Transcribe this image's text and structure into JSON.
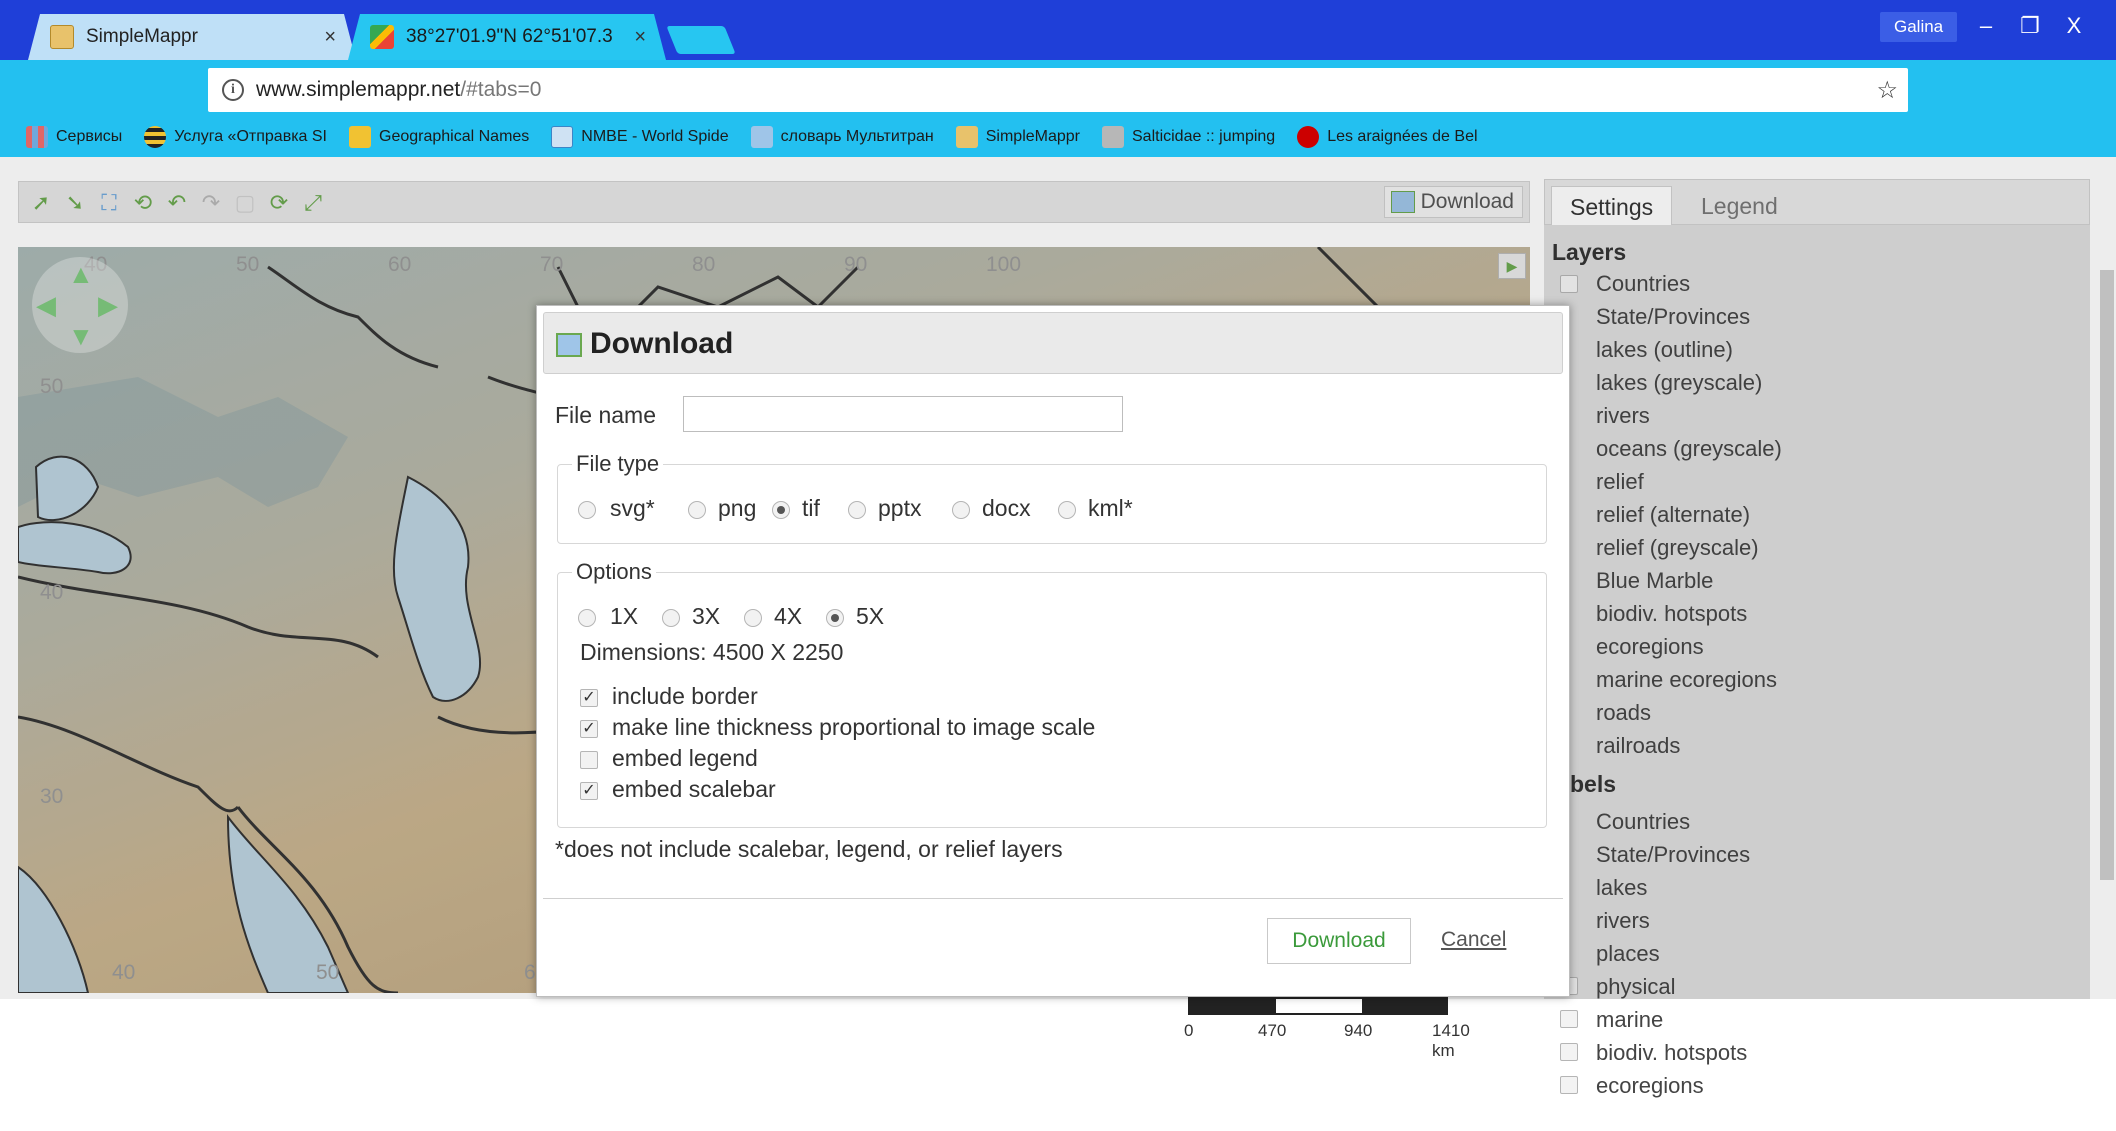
{
  "browser": {
    "tabs": [
      {
        "title": "SimpleMappr",
        "close": "×"
      },
      {
        "title": "38°27'01.9\"N 62°51'07.3",
        "close": "×"
      }
    ],
    "user": "Galina",
    "window_controls": {
      "minimize": "–",
      "restore": "❐",
      "close": "X"
    },
    "url": {
      "host": "www.simplemappr.net",
      "path": "/#tabs=0"
    },
    "bookmarks": [
      "Сервисы",
      "Услуга «Отправка SI",
      "Geographical Names",
      "NMBE - World Spide",
      "словарь Мультитран",
      "SimpleMappr",
      "Salticidae :: jumping",
      "Les araignées de Bel"
    ]
  },
  "toolbar": {
    "download_label": "Download",
    "tools": [
      "zoom-in",
      "zoom-out",
      "crop",
      "rotate",
      "undo",
      "redo",
      "blank",
      "refresh",
      "fullscreen"
    ]
  },
  "map": {
    "top_ticks": [
      "40",
      "50",
      "60",
      "70",
      "80",
      "90",
      "100"
    ],
    "left_ticks": [
      "50",
      "40",
      "30"
    ],
    "bottom_ticks": [
      "40",
      "50",
      "6"
    ],
    "scalebar": [
      "0",
      "470",
      "940",
      "1410 km"
    ]
  },
  "panel": {
    "tabs": [
      "Settings",
      "Legend"
    ],
    "layers_heading": "Layers",
    "layers": [
      "Countries",
      "State/Provinces",
      "lakes (outline)",
      "lakes (greyscale)",
      "rivers",
      "oceans (greyscale)",
      "relief",
      "relief (alternate)",
      "relief (greyscale)",
      "Blue Marble",
      "biodiv. hotspots",
      "ecoregions",
      "marine ecoregions",
      "roads",
      "railroads"
    ],
    "labels_heading": "bels",
    "labels": [
      "Countries",
      "State/Provinces",
      "lakes",
      "rivers",
      "places",
      "physical",
      "marine",
      "biodiv. hotspots",
      "ecoregions"
    ]
  },
  "dialog": {
    "title": "Download",
    "file_name_label": "File name",
    "file_name_value": "",
    "file_type_legend": "File type",
    "file_types": [
      {
        "label": "svg*",
        "selected": false
      },
      {
        "label": "png",
        "selected": false
      },
      {
        "label": "tif",
        "selected": true
      },
      {
        "label": "pptx",
        "selected": false
      },
      {
        "label": "docx",
        "selected": false
      },
      {
        "label": "kml*",
        "selected": false
      }
    ],
    "options_legend": "Options",
    "scales": [
      {
        "label": "1X",
        "selected": false
      },
      {
        "label": "3X",
        "selected": false
      },
      {
        "label": "4X",
        "selected": false
      },
      {
        "label": "5X",
        "selected": true
      }
    ],
    "dimensions": "Dimensions: 4500 X 2250",
    "checkboxes": [
      {
        "label": "include border",
        "checked": true
      },
      {
        "label": "make line thickness proportional to image scale",
        "checked": true
      },
      {
        "label": "embed legend",
        "checked": false
      },
      {
        "label": "embed scalebar",
        "checked": true
      }
    ],
    "footnote": "*does not include scalebar, legend, or relief layers",
    "download_button": "Download",
    "cancel_link": "Cancel"
  }
}
